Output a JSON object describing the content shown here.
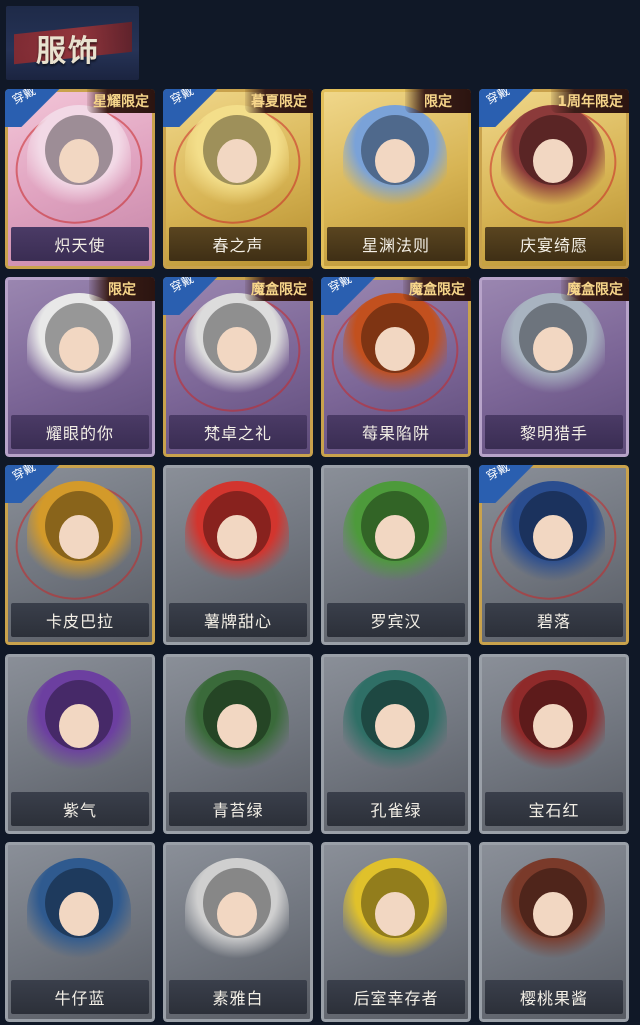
{
  "header": {
    "title": "服饰"
  },
  "cards": [
    {
      "name": "炽天使",
      "style": "pink",
      "equipped": true,
      "badge": "星耀限定",
      "accent": "#f2d9e6"
    },
    {
      "name": "春之声",
      "style": "gold",
      "equipped": true,
      "badge": "暮夏限定",
      "accent": "#f3de8a"
    },
    {
      "name": "星渊法则",
      "style": "gold",
      "equipped": false,
      "badge": "限定",
      "accent": "#7aa2d8"
    },
    {
      "name": "庆宴绮愿",
      "style": "gold",
      "equipped": true,
      "badge": "1周年限定",
      "accent": "#8b3a3a"
    },
    {
      "name": "耀眼的你",
      "style": "purple",
      "equipped": false,
      "badge": "限定",
      "accent": "#e8e8e8"
    },
    {
      "name": "梵卓之礼",
      "style": "purple",
      "equipped": true,
      "badge": "魔盒限定",
      "accent": "#dcdcdc"
    },
    {
      "name": "莓果陷阱",
      "style": "purple",
      "equipped": true,
      "badge": "魔盒限定",
      "accent": "#c2501e"
    },
    {
      "name": "黎明猎手",
      "style": "purple",
      "equipped": false,
      "badge": "魔盒限定",
      "accent": "#a8b3c0"
    },
    {
      "name": "卡皮巴拉",
      "style": "grey",
      "equipped": true,
      "badge": "",
      "accent": "#d39a2a"
    },
    {
      "name": "薯牌甜心",
      "style": "grey",
      "equipped": false,
      "badge": "",
      "accent": "#d2352e"
    },
    {
      "name": "罗宾汉",
      "style": "grey",
      "equipped": false,
      "badge": "",
      "accent": "#4d9a3b"
    },
    {
      "name": "碧落",
      "style": "grey",
      "equipped": true,
      "badge": "",
      "accent": "#2a4d8f"
    },
    {
      "name": "紫气",
      "style": "grey",
      "equipped": false,
      "badge": "",
      "accent": "#6c3fa0"
    },
    {
      "name": "青苔绿",
      "style": "grey",
      "equipped": false,
      "badge": "",
      "accent": "#3a6a3a"
    },
    {
      "name": "孔雀绿",
      "style": "grey",
      "equipped": false,
      "badge": "",
      "accent": "#2f6f66"
    },
    {
      "name": "宝石红",
      "style": "grey",
      "equipped": false,
      "badge": "",
      "accent": "#8f2a2a"
    },
    {
      "name": "牛仔蓝",
      "style": "grey",
      "equipped": false,
      "badge": "",
      "accent": "#2f5a8f"
    },
    {
      "name": "素雅白",
      "style": "grey",
      "equipped": false,
      "badge": "",
      "accent": "#cfcfcf"
    },
    {
      "name": "后室幸存者",
      "style": "grey",
      "equipped": false,
      "badge": "",
      "accent": "#e0c12b"
    },
    {
      "name": "樱桃果酱",
      "style": "grey",
      "equipped": false,
      "badge": "",
      "accent": "#7a3a2a"
    }
  ],
  "equipped_label": "穿戴"
}
